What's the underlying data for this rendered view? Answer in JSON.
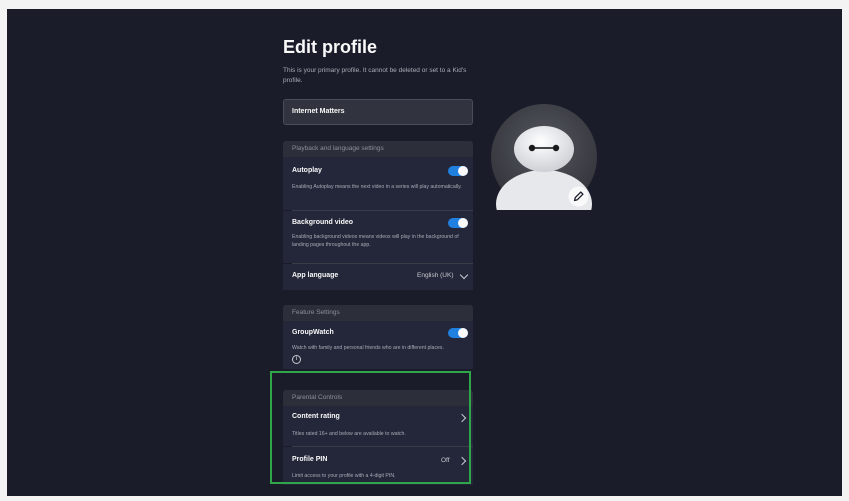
{
  "page": {
    "title": "Edit profile",
    "subtitle": "This is your primary profile. It cannot be deleted or set to a Kid's profile."
  },
  "profile_name_field": {
    "value": "Internet Matters"
  },
  "playback_section": {
    "header": "Playback and language settings",
    "autoplay": {
      "title": "Autoplay",
      "description": "Enabling Autoplay means the next video in a series will play automatically.",
      "enabled": true
    },
    "background_video": {
      "title": "Background video",
      "description": "Enabling background videos means videos will play in the background of landing pages throughout the app.",
      "enabled": true
    },
    "app_language": {
      "title": "App language",
      "value": "English (UK)"
    }
  },
  "feature_section": {
    "header": "Feature Settings",
    "groupwatch": {
      "title": "GroupWatch",
      "description": "Watch with family and personal friends who are in different places.",
      "enabled": true
    }
  },
  "parental_controls": {
    "header": "Parental Controls",
    "content_rating": {
      "title": "Content rating",
      "description": "Titles rated 16+ and below are available to watch."
    },
    "profile_pin": {
      "title": "Profile PIN",
      "value": "Off",
      "description": "Limit access to your profile with a 4-digit PIN."
    }
  },
  "colors": {
    "background": "#1a1d29",
    "panel": "#2c2f3a",
    "toggle_on": "#1f80e0",
    "highlight": "#2fa64a"
  },
  "icons": [
    "chevron-down-icon",
    "chevron-right-icon",
    "info-icon",
    "pencil-icon",
    "baymax-avatar"
  ]
}
